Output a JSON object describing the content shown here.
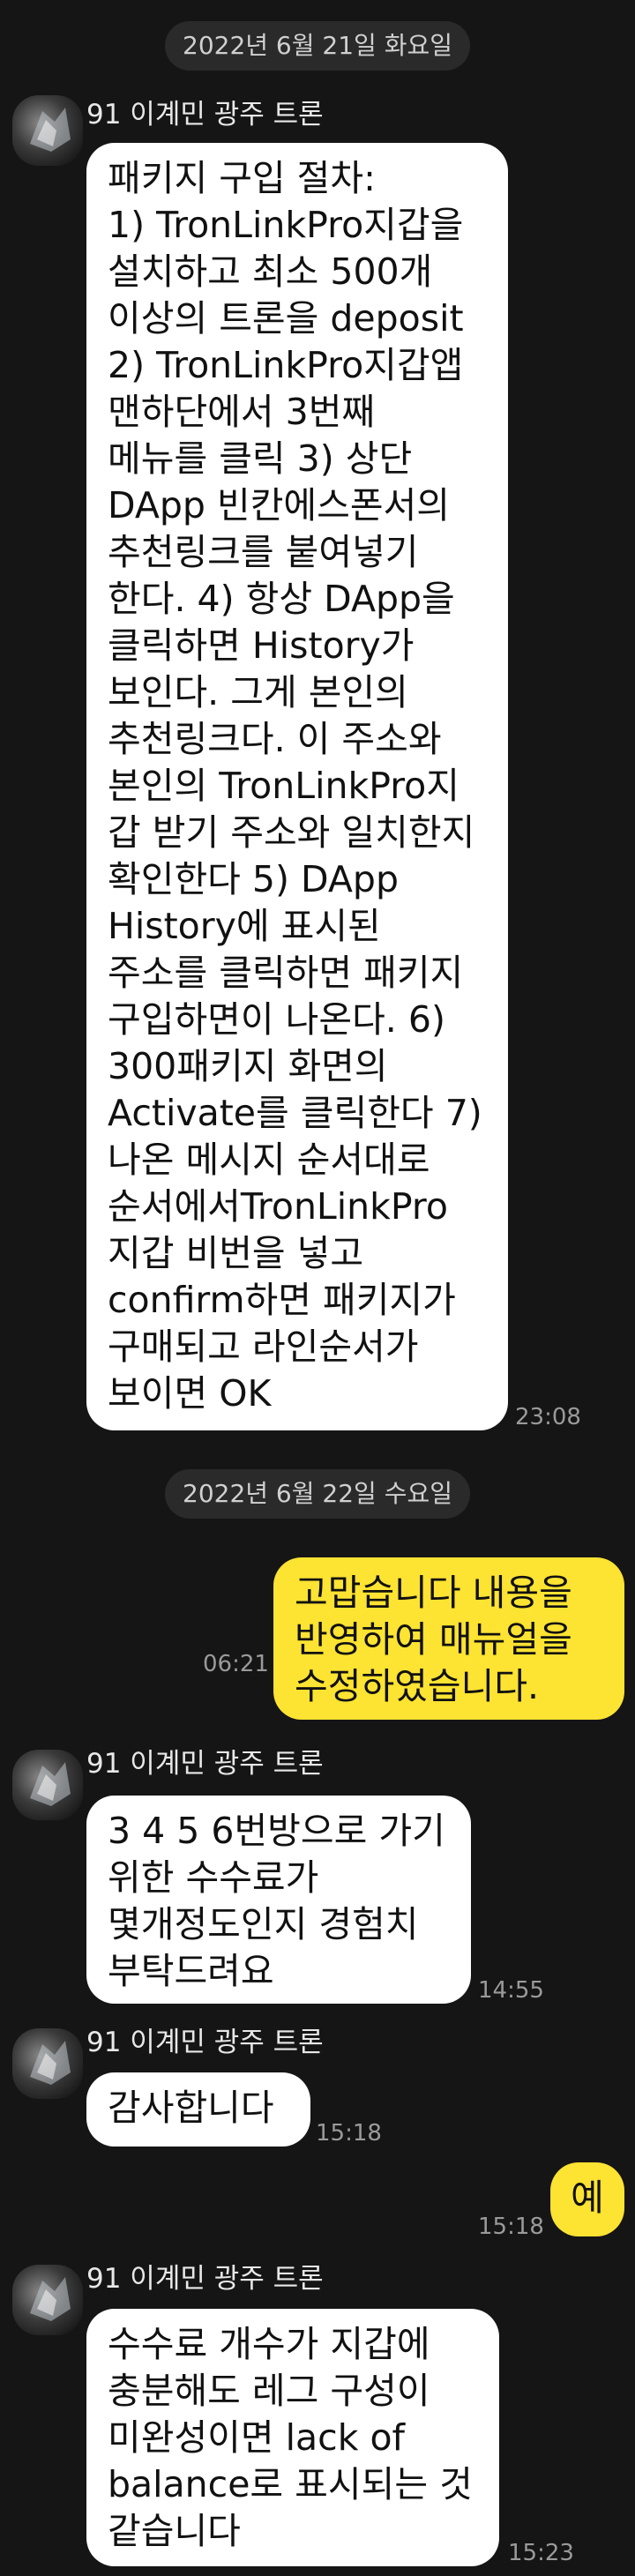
{
  "dates": [
    "2022년 6월 21일 화요일",
    "2022년 6월 22일 수요일"
  ],
  "sender_name": "91 이계민 광주 트론",
  "messages": [
    {
      "dir": "in",
      "text": "패키지 구입 절차:\n1) TronLinkPro지갑을\n설치하고 최소 500개\n이상의 트론을 deposit\n2) TronLinkPro지갑앱\n맨하단에서 3번째\n메뉴를 클릭 3) 상단\nDApp 빈칸에스폰서의\n추천링크를 붙여넣기\n한다. 4) 항상 DApp을\n클릭하면 History가\n보인다. 그게 본인의\n추천링크다. 이 주소와\n본인의 TronLinkPro지\n갑 받기 주소와 일치한지\n확인한다 5) DApp\nHistory에 표시된\n주소를 클릭하면 패키지\n구입하면이 나온다. 6)\n300패키지 화면의\nActivate를 클릭한다 7)\n나온 메시지 순서대로\n순서에서TronLinkPro\n지갑 비번을 넣고\nconfirm하면 패키지가\n구매되고 라인순서가\n보이면 OK",
      "time": "23:08"
    },
    {
      "dir": "out",
      "text": "고맙습니다  내용을\n반영하여 매뉴얼을\n수정하였습니다.",
      "time": "06:21"
    },
    {
      "dir": "in",
      "text": "3 4 5 6번방으로 가기\n위한 수수료가\n몇개정도인지 경험치\n부탁드려요",
      "time": "14:55"
    },
    {
      "dir": "in",
      "text": "감사합니다",
      "time": "15:18"
    },
    {
      "dir": "out",
      "text": "예",
      "time": "15:18"
    },
    {
      "dir": "in",
      "text": "수수료 개수가 지갑에\n충분해도  레그 구성이\n미완성이면 lack of\nbalance로 표시되는 것\n같습니다",
      "time": "15:23"
    }
  ]
}
